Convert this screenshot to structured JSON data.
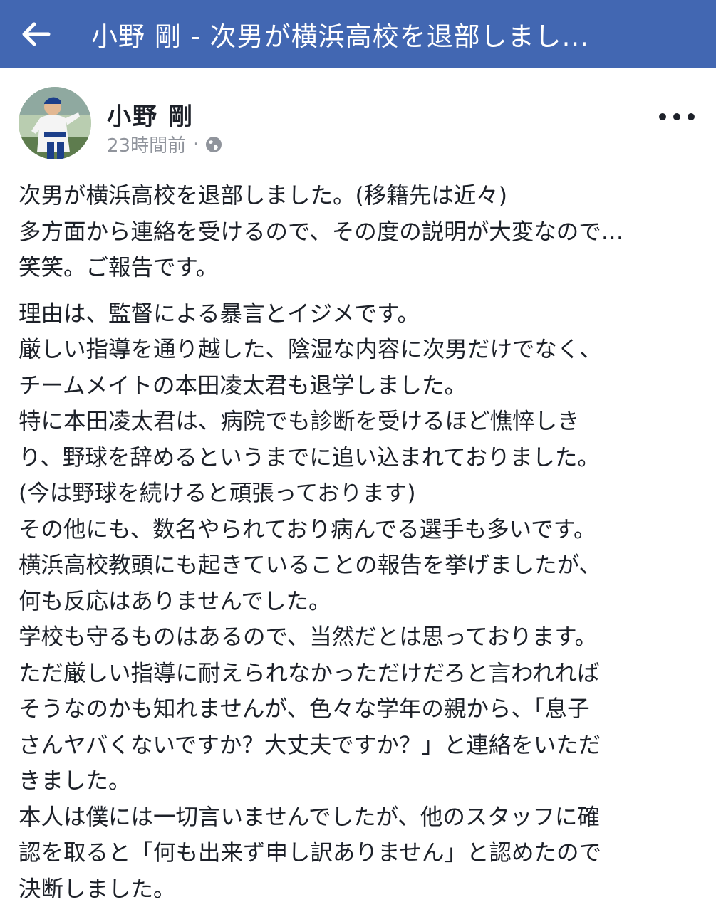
{
  "header": {
    "title": "小野 剛 - 次男が横浜高校を退部しまし..."
  },
  "post": {
    "author": "小野 剛",
    "timestamp": "23時間前",
    "separator": "·",
    "audience_icon": "globe-icon",
    "paragraphs": [
      {
        "lines": [
          "次男が横浜高校を退部しました。(移籍先は近々)",
          "多方面から連絡を受けるので、その度の説明が大変なので…",
          "笑笑。ご報告です。"
        ]
      },
      {
        "lines": [
          "理由は、監督による暴言とイジメです。",
          "厳しい指導を通り越した、陰湿な内容に次男だけでなく、",
          "チームメイトの本田凌太君も退学しました。",
          "特に本田凌太君は、病院でも診断を受けるほど憔悴しき",
          "り、野球を辞めるというまでに追い込まれておりました。",
          "(今は野球を続けると頑張っております)",
          "その他にも、数名やられており病んでる選手も多いです。",
          "横浜高校教頭にも起きていることの報告を挙げましたが、",
          "何も反応はありませんでした。",
          "学校も守るものはあるので、当然だとは思っております。",
          "ただ厳しい指導に耐えられなかっただけだろと言われれば",
          "そうなのかも知れませんが、色々な学年の親から、「息子",
          "さんヤバくないですか？大丈夫ですか？」と連絡をいただ",
          "きました。",
          "本人は僕には一切言いませんでしたが、他のスタッフに確",
          "認を取ると「何も出来ず申し訳ありません」と認めたので",
          "決断しました。"
        ]
      }
    ]
  },
  "colors": {
    "app_bar": "#4267b2",
    "text": "#1d2129",
    "meta": "#90949c"
  }
}
